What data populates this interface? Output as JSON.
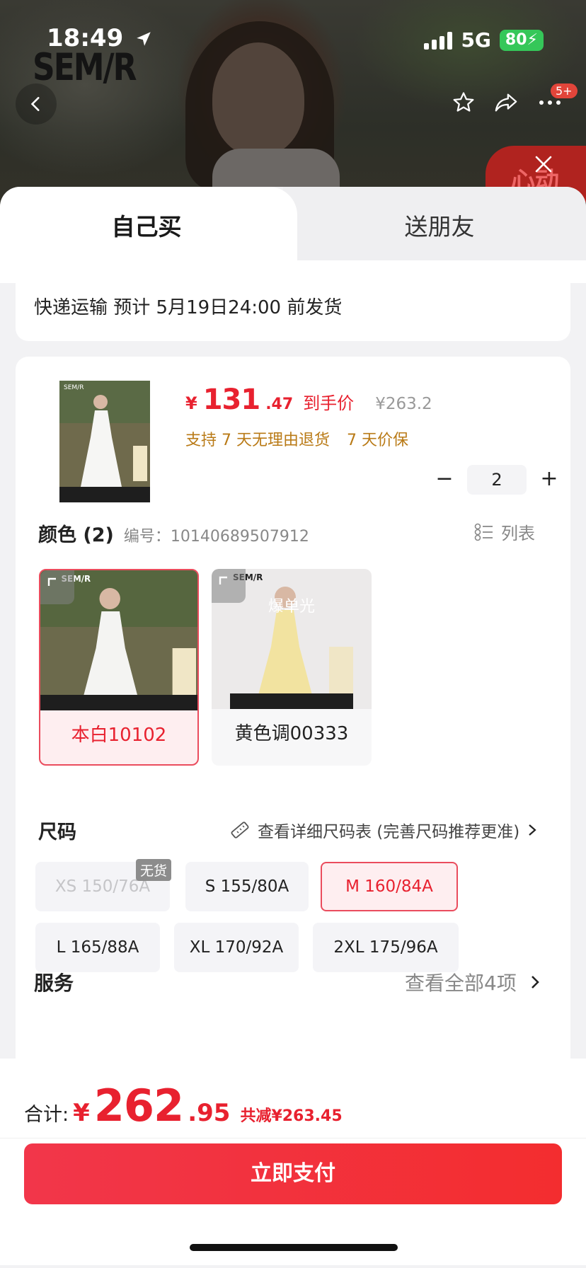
{
  "status_bar": {
    "time": "18:49",
    "network": "5G",
    "battery": "80"
  },
  "header": {
    "brand_logo": "SEM/R",
    "notification_count": "5+",
    "badge_text": "心动"
  },
  "tabs": [
    {
      "label": "自己买",
      "selected": true
    },
    {
      "label": "送朋友",
      "selected": false
    }
  ],
  "shipping": {
    "text": "快递运输  预计 5月19日24:00 前发货"
  },
  "product": {
    "price_symbol": "¥",
    "price_int": "131",
    "price_dec": ".47",
    "price_tag": "到手价",
    "original_price": "¥263.2",
    "promises": [
      "支持 7 天无理由退货",
      "7 天价保"
    ],
    "quantity": "2",
    "minus": "−",
    "plus": "+"
  },
  "color": {
    "title": "颜色 (2)",
    "code": "编号：10140689507912",
    "list_label": "列表",
    "options": [
      {
        "label": "本白10102",
        "selected": true,
        "dress_color": "#f4f4f2"
      },
      {
        "label": "黄色调00333",
        "selected": false,
        "dress_color": "#f2e3a0",
        "overlay_text": "爆单光"
      }
    ]
  },
  "size": {
    "title": "尺码",
    "guide_label": "查看详细尺码表 (完善尺码推荐更准)",
    "out_of_stock_label": "无货",
    "options": [
      {
        "label": "XS 150/76A",
        "state": "disabled"
      },
      {
        "label": "S 155/80A",
        "state": "normal"
      },
      {
        "label": "M 160/84A",
        "state": "selected"
      },
      {
        "label": "L 165/88A",
        "state": "normal"
      },
      {
        "label": "XL 170/92A",
        "state": "normal"
      },
      {
        "label": "2XL 175/96A",
        "state": "normal"
      }
    ]
  },
  "service": {
    "title": "服务",
    "more_label": "查看全部4项"
  },
  "footer": {
    "total_label": "合计:",
    "total_symbol": "¥",
    "total_int": "262",
    "total_dec": ".95",
    "discount": "共减¥263.45",
    "pay_label": "立即支付"
  },
  "colors": {
    "accent": "#e8212f",
    "promise": "#b97a16",
    "battery": "#35c759"
  }
}
